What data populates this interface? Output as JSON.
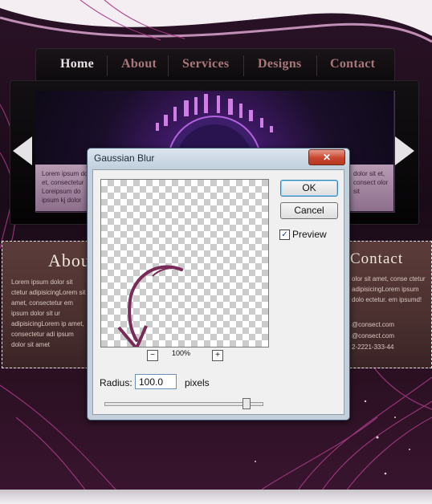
{
  "nav": {
    "items": [
      "Home",
      "About",
      "Services",
      "Designs",
      "Contact"
    ],
    "active": "Home"
  },
  "slider": {
    "caption_left": "Lorem ipsum dol et, consectetur Loreipsum do ipsum kj dolor",
    "caption_right": "dolor sit et, consect olor sit"
  },
  "about": {
    "title": "About",
    "text": "Lorem ipsum dolor sit ctetur adipisicingLorem sit amet, consectetur em ipsum dolor sit ur adipisicingLorem ip amet, consectetur adi ipsum dolor sit amet"
  },
  "contact": {
    "title": "Contact",
    "text": "olor sit amet, conse ctetur adipisicingLorem ipsum dolo ectetur. em ipsumd!",
    "info": [
      "@consect.com",
      "@consect.com",
      "2-2221-333-44"
    ]
  },
  "dialog": {
    "title": "Gaussian Blur",
    "close_glyph": "✕",
    "ok_label": "OK",
    "cancel_label": "Cancel",
    "preview_label": "Preview",
    "preview_checked": true,
    "check_glyph": "✓",
    "zoom_out_glyph": "−",
    "zoom_in_glyph": "+",
    "zoom": "100%",
    "radius_label": "Radius:",
    "radius_value": "100.0",
    "radius_unit": "pixels",
    "radius_slider_fraction": 0.9
  },
  "colors": {
    "nav_active": "#e9e2e4",
    "nav_inactive": "#a8777a",
    "close_button": "#c8452e",
    "arrow_annotation": "#7a2a58"
  }
}
